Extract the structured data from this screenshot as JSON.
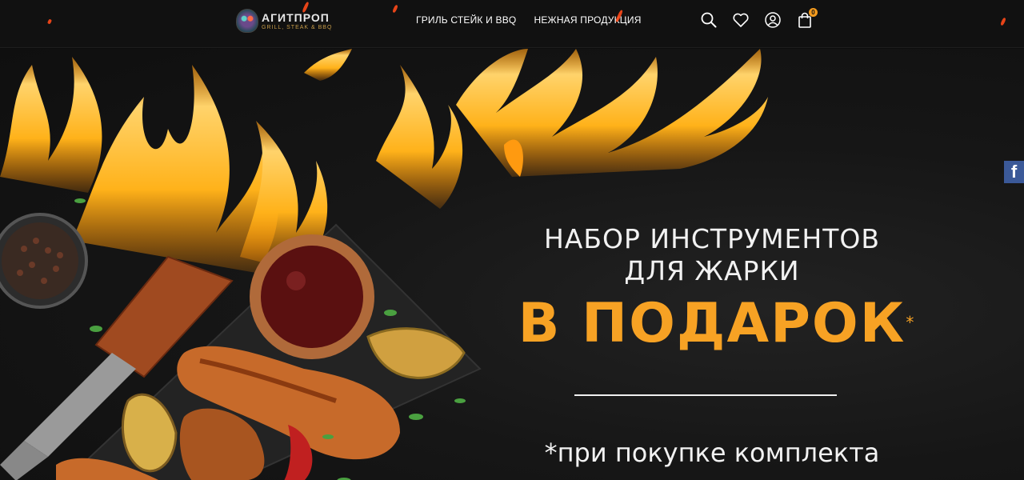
{
  "header": {
    "logo": {
      "title": "АГИТПРОП",
      "subtitle": "GRILL, STEAK & BBQ"
    },
    "nav": [
      {
        "label": "ГРИЛЬ СТЕЙК И BBQ"
      },
      {
        "label": "НЕЖНАЯ ПРОДУКЦИЯ"
      }
    ],
    "icons": {
      "search": "search-icon",
      "favorites": "heart-icon",
      "account": "user-icon",
      "cart": "shopping-bag-icon"
    },
    "cart_count": "0"
  },
  "hero": {
    "line1": "НАБОР ИНСТРУМЕНТОВ",
    "line2": "ДЛЯ ЖАРКИ",
    "accent": "В ПОДАРОК",
    "asterisk": "*",
    "note": "*при покупке комплекта"
  },
  "social": {
    "facebook": "f"
  },
  "colors": {
    "accent": "#f7a224",
    "header_bg": "#111111",
    "facebook": "#3b5998"
  }
}
